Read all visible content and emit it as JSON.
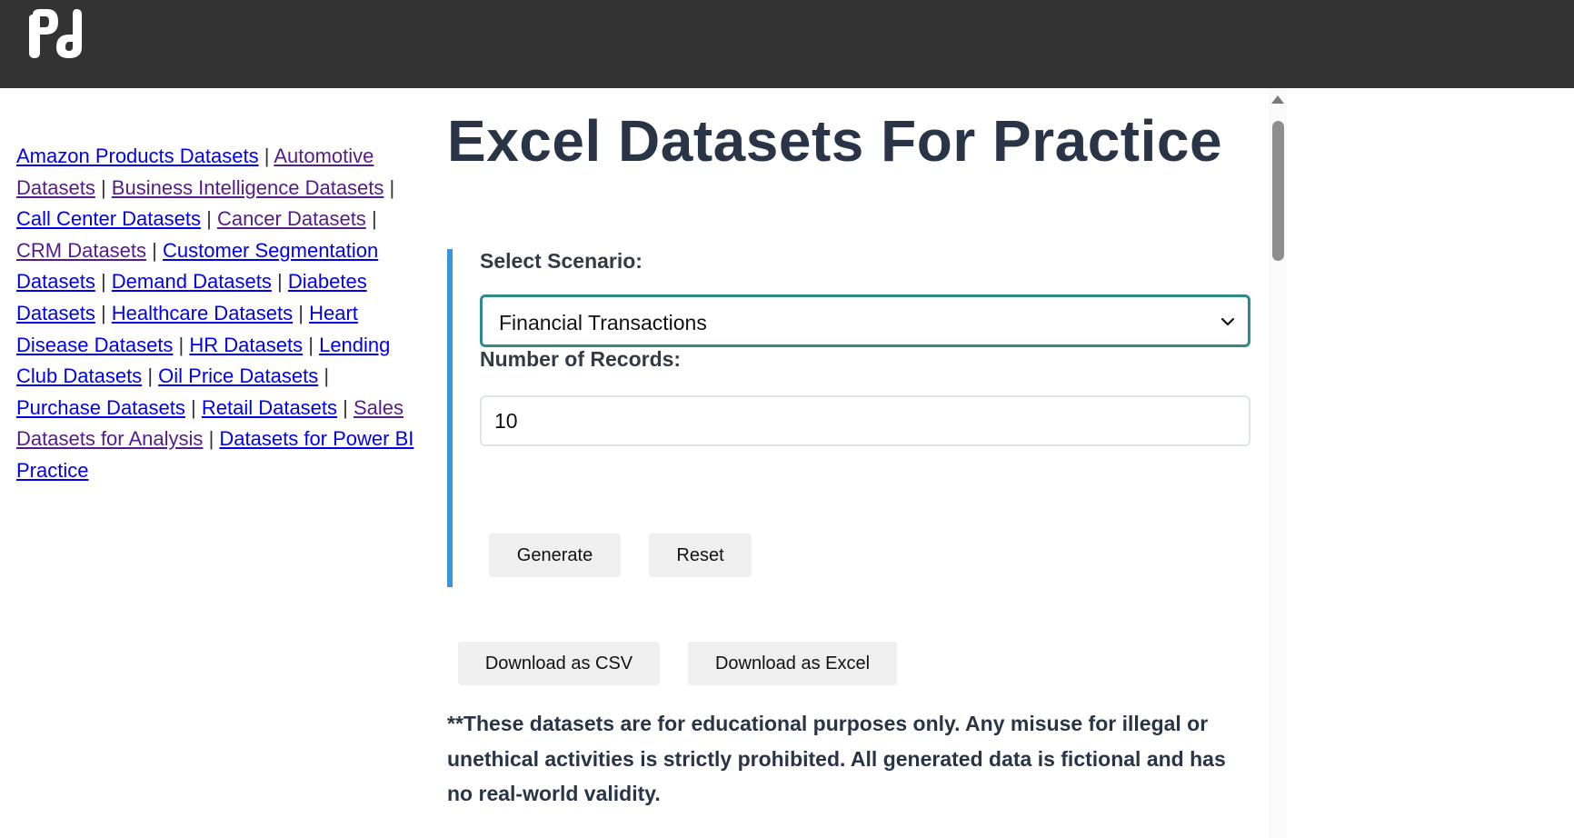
{
  "header": {
    "logo_text": "Pd"
  },
  "sidebar": {
    "links": [
      {
        "label": "Amazon Products Datasets",
        "visited": false
      },
      {
        "label": "Automotive Datasets",
        "visited": true
      },
      {
        "label": "Business Intelligence Datasets",
        "visited": true
      },
      {
        "label": "Call Center Datasets",
        "visited": false
      },
      {
        "label": "Cancer Datasets",
        "visited": true
      },
      {
        "label": "CRM Datasets",
        "visited": true
      },
      {
        "label": "Customer Segmentation Datasets",
        "visited": false
      },
      {
        "label": "Demand Datasets",
        "visited": false
      },
      {
        "label": "Diabetes Datasets",
        "visited": false
      },
      {
        "label": "Healthcare Datasets",
        "visited": false
      },
      {
        "label": "Heart Disease Datasets",
        "visited": false
      },
      {
        "label": "HR Datasets",
        "visited": false
      },
      {
        "label": "Lending Club Datasets",
        "visited": false
      },
      {
        "label": "Oil Price Datasets",
        "visited": false
      },
      {
        "label": "Purchase Datasets",
        "visited": false
      },
      {
        "label": "Retail Datasets",
        "visited": false
      },
      {
        "label": "Sales Datasets for Analysis",
        "visited": true
      },
      {
        "label": "Datasets for Power BI Practice",
        "visited": false
      }
    ],
    "separator": "|"
  },
  "main": {
    "title": "Excel Datasets For Practice",
    "form": {
      "scenario_label": "Select Scenario:",
      "scenario_value": "Financial Transactions",
      "records_label": "Number of Records:",
      "records_value": "10",
      "generate_label": "Generate",
      "reset_label": "Reset"
    },
    "download": {
      "csv_label": "Download as CSV",
      "excel_label": "Download as Excel"
    },
    "notice": "**These datasets are for educational purposes only. Any misuse for illegal or unethical activities is strictly prohibited. All generated data is fictional and has no real-world validity."
  },
  "colors": {
    "header_bg": "#333333",
    "accent_border": "#3a95d8",
    "select_border": "#2d8c87",
    "link": "#0000ee",
    "link_visited": "#551a8b",
    "title": "#2a3447"
  },
  "icons": {
    "logo": "pd-logo-icon",
    "select_caret": "chevron-down-icon",
    "scroll_up": "scroll-up-arrow-icon"
  }
}
